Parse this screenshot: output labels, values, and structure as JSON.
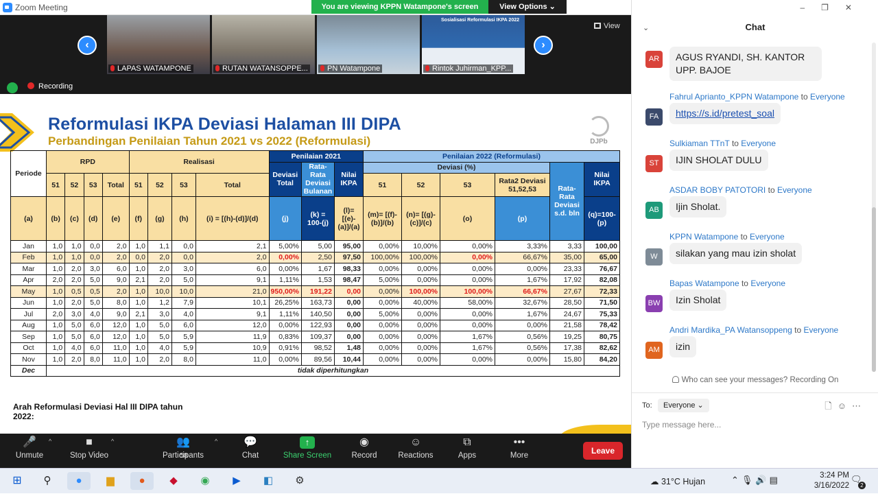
{
  "window": {
    "title": "Zoom Meeting"
  },
  "share_banner": "You are viewing KPPN Watampone's screen",
  "view_options": "View Options ⌄",
  "video_tiles": [
    {
      "label": "LAPAS WATAMPONE"
    },
    {
      "label": "RUTAN WATANSOPPE..."
    },
    {
      "label": "PN Watampone"
    },
    {
      "label": "Rintok Juhirman_KPP..."
    }
  ],
  "tile4_overlay": "Sosialisasi Reformulasi IKPA 2022",
  "view_button": "View",
  "recording": "Recording",
  "slide": {
    "title": "Reformulasi IKPA Deviasi Halaman III DIPA",
    "subtitle": "Perbandingan Penilaian Tahun 2021 vs 2022 (Reformulasi)",
    "logo_text": "DJPb",
    "note": "Arah Reformulasi Deviasi Hal III DIPA tahun 2022:",
    "table": {
      "h_periode": "Periode",
      "h_rpd": "RPD",
      "h_realisasi": "Realisasi",
      "h_p2021": "Penilaian 2021",
      "h_p2022": "Penilaian 2022 (Reformulasi)",
      "h_deviasi_pct": "Deviasi (%)",
      "h_51": "51",
      "h_52": "52",
      "h_53": "53",
      "h_total": "Total",
      "h_dev_total": "Deviasi Total",
      "h_rata_bulanan": "Rata-Rata Deviasi Bulanan",
      "h_nilai_ikpa": "Nilai IKPA",
      "h_rata2_dev": "Rata2 Deviasi 51,52,53",
      "h_rata_sd": "Rata-Rata Deviasi s.d. bln",
      "f_a": "(a)",
      "f_b": "(b)",
      "f_c": "(c)",
      "f_d": "(d)",
      "f_e": "(e)",
      "f_f": "(f)",
      "f_g": "(g)",
      "f_h": "(h)",
      "f_i": "(i) = [(h)-(d)]/(d)",
      "f_j": "(j)",
      "f_k": "(k) = 100-(j)",
      "f_l": "(l)= [(e)-(a)]/(a)",
      "f_m": "(m)= [(f)-(b)]/(b)",
      "f_n": "(n)= [(g)-(c)]/(c)",
      "f_o": "(o)",
      "f_p": "(p)",
      "f_q": "(q)=100-(p)",
      "rows": [
        [
          "Jan",
          "1,0",
          "1,0",
          "0,0",
          "2,0",
          "1,0",
          "1,1",
          "0,0",
          "2,1",
          "5,00%",
          "5,00",
          "95,00",
          "0,00%",
          "10,00%",
          "0,00%",
          "3,33%",
          "3,33",
          "100,00"
        ],
        [
          "Feb",
          "1,0",
          "1,0",
          "0,0",
          "2,0",
          "0,0",
          "2,0",
          "0,0",
          "2,0",
          "0,00%",
          "2,50",
          "97,50",
          "100,00%",
          "100,00%",
          "0,00%",
          "66,67%",
          "35,00",
          "65,00"
        ],
        [
          "Mar",
          "1,0",
          "2,0",
          "3,0",
          "6,0",
          "1,0",
          "2,0",
          "3,0",
          "6,0",
          "0,00%",
          "1,67",
          "98,33",
          "0,00%",
          "0,00%",
          "0,00%",
          "0,00%",
          "23,33",
          "76,67"
        ],
        [
          "Apr",
          "2,0",
          "2,0",
          "5,0",
          "9,0",
          "2,1",
          "2,0",
          "5,0",
          "9,1",
          "1,11%",
          "1,53",
          "98,47",
          "5,00%",
          "0,00%",
          "0,00%",
          "1,67%",
          "17,92",
          "82,08"
        ],
        [
          "May",
          "1,0",
          "0,5",
          "0,5",
          "2,0",
          "1,0",
          "10,0",
          "10,0",
          "21,0",
          "950,00%",
          "191,22",
          "0,00",
          "0,00%",
          "100,00%",
          "100,00%",
          "66,67%",
          "27,67",
          "72,33"
        ],
        [
          "Jun",
          "1,0",
          "2,0",
          "5,0",
          "8,0",
          "1,0",
          "1,2",
          "7,9",
          "10,1",
          "26,25%",
          "163,73",
          "0,00",
          "0,00%",
          "40,00%",
          "58,00%",
          "32,67%",
          "28,50",
          "71,50"
        ],
        [
          "Jul",
          "2,0",
          "3,0",
          "4,0",
          "9,0",
          "2,1",
          "3,0",
          "4,0",
          "9,1",
          "1,11%",
          "140,50",
          "0,00",
          "5,00%",
          "0,00%",
          "0,00%",
          "1,67%",
          "24,67",
          "75,33"
        ],
        [
          "Aug",
          "1,0",
          "5,0",
          "6,0",
          "12,0",
          "1,0",
          "5,0",
          "6,0",
          "12,0",
          "0,00%",
          "122,93",
          "0,00",
          "0,00%",
          "0,00%",
          "0,00%",
          "0,00%",
          "21,58",
          "78,42"
        ],
        [
          "Sep",
          "1,0",
          "5,0",
          "6,0",
          "12,0",
          "1,0",
          "5,0",
          "5,9",
          "11,9",
          "0,83%",
          "109,37",
          "0,00",
          "0,00%",
          "0,00%",
          "1,67%",
          "0,56%",
          "19,25",
          "80,75"
        ],
        [
          "Oct",
          "1,0",
          "4,0",
          "6,0",
          "11,0",
          "1,0",
          "4,0",
          "5,9",
          "10,9",
          "0,91%",
          "98,52",
          "1,48",
          "0,00%",
          "0,00%",
          "1,67%",
          "0,56%",
          "17,38",
          "82,62"
        ],
        [
          "Nov",
          "1,0",
          "2,0",
          "8,0",
          "11,0",
          "1,0",
          "2,0",
          "8,0",
          "11,0",
          "0,00%",
          "89,56",
          "10,44",
          "0,00%",
          "0,00%",
          "0,00%",
          "0,00%",
          "15,80",
          "84,20"
        ]
      ],
      "dec_label": "Dec",
      "dec_note": "tidak diperhitungkan"
    }
  },
  "toolbar": {
    "unmute": "Unmute",
    "stop_video": "Stop Video",
    "participants": "Participants",
    "participants_count": "58",
    "chat": "Chat",
    "share_screen": "Share Screen",
    "record": "Record",
    "reactions": "Reactions",
    "apps": "Apps",
    "more": "More",
    "leave": "Leave"
  },
  "chat": {
    "header": "Chat",
    "messages": [
      {
        "initials": "AR",
        "color": "#d9433a",
        "sender": "",
        "to": "",
        "text": "AGUS RYANDI, SH. KANTOR UPP. BAJOE"
      },
      {
        "initials": "FA",
        "color": "#3b4a6b",
        "sender": "Fahrul Aprianto_KPPN Watampone",
        "to": "to",
        "recipient": "Everyone",
        "text": "https://s.id/pretest_soal"
      },
      {
        "initials": "ST",
        "color": "#d9433a",
        "sender": "Sulkiaman TTnT",
        "to": "to",
        "recipient": "Everyone",
        "text": "IJIN SHOLAT DULU"
      },
      {
        "initials": "AB",
        "color": "#1e9a7a",
        "sender": "ASDAR BOBY PATOTORI",
        "to": "to",
        "recipient": "Everyone",
        "text": "Ijin Sholat."
      },
      {
        "initials": "W",
        "color": "#7e8b97",
        "sender": "KPPN Watampone",
        "to": "to",
        "recipient": "Everyone",
        "text": "silakan yang mau izin sholat"
      },
      {
        "initials": "BW",
        "color": "#8a3fb0",
        "sender": "Bapas Watampone",
        "to": "to",
        "recipient": "Everyone",
        "text": "Izin Sholat"
      },
      {
        "initials": "AM",
        "color": "#e0651f",
        "sender": "Andri Mardika_PA Watansoppeng",
        "to": "to",
        "recipient": "Everyone",
        "text": "izin"
      }
    ],
    "privacy_note": "Who can see your messages? Recording On",
    "to_label": "To:",
    "recipient": "Everyone ⌄",
    "input_placeholder": "Type message here..."
  },
  "taskbar": {
    "weather": "31°C  Hujan",
    "time": "3:24 PM",
    "date": "3/16/2022",
    "notifications": "2"
  }
}
